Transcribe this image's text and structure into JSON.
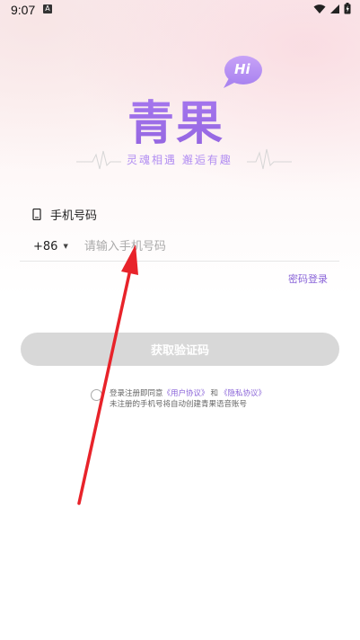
{
  "status_bar": {
    "time": "9:07",
    "notification_icon": "A",
    "icons": [
      "wifi-icon",
      "signal-icon",
      "battery-icon"
    ]
  },
  "logo": {
    "bubble_text": "Hi",
    "title": "青果",
    "slogan": "灵魂相遇 邂逅有趣"
  },
  "phone_section": {
    "label": "手机号码",
    "icon": "phone-icon",
    "country_code": "+86",
    "placeholder": "请输入手机号码",
    "value": ""
  },
  "password_login_link": "密码登录",
  "get_code_button": "获取验证码",
  "agreement": {
    "prefix": "登录注册即同意",
    "user_agreement": "《用户协议》",
    "and": "和",
    "privacy_agreement": "《隐私协议》",
    "line2": "未注册的手机号将自动创建青果语音账号"
  },
  "colors": {
    "accent": "#9364e0",
    "link": "#8a64d8",
    "button_disabled": "#d8d8d8",
    "annotation_arrow": "#e8232a"
  }
}
